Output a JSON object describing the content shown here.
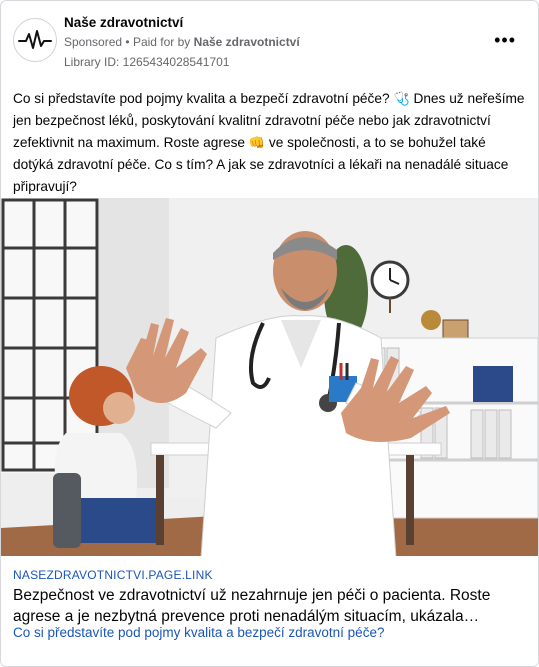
{
  "header": {
    "page_name": "Naše zdravotnictví",
    "sponsored_label": "Sponsored",
    "separator": "•",
    "paid_for_label": "Paid for by",
    "paid_for_name": "Naše zdravotnictví",
    "library_id": "Library ID: 1265434028541701",
    "more_label": "•••",
    "avatar_icon": "heartbeat-icon"
  },
  "body": {
    "text_1": "Co si představíte pod pojmy kvalita a bezpečí zdravotní péče?",
    "emoji_1": "🩺",
    "text_2": "Dnes už neřešíme jen bezpečnost léků, poskytování kvalitní zdravotní péče nebo jak zdravotnictví zefektivnit na maximum. Roste agrese",
    "emoji_2": "👊",
    "text_3": "ve společnosti, a to se bohužel také dotýká zdravotní péče. Co s tím? A jak se zdravotníci a lékaři na nenadálé situace připravují?"
  },
  "link": {
    "domain": "NASEZDRAVOTNICTVI.PAGE.LINK",
    "headline": "Bezpečnost ve zdravotnictví už nezahrnuje jen péči o pacienta. Roste agrese a je nezbytná prevence proti nenadálým situacím, ukázala…",
    "description": "Co si představíte pod pojmy kvalita a bezpečí zdravotní péče?"
  },
  "colors": {
    "link_blue": "#1a56b8",
    "secondary_text": "#65676b",
    "border": "#d6d8dc"
  }
}
